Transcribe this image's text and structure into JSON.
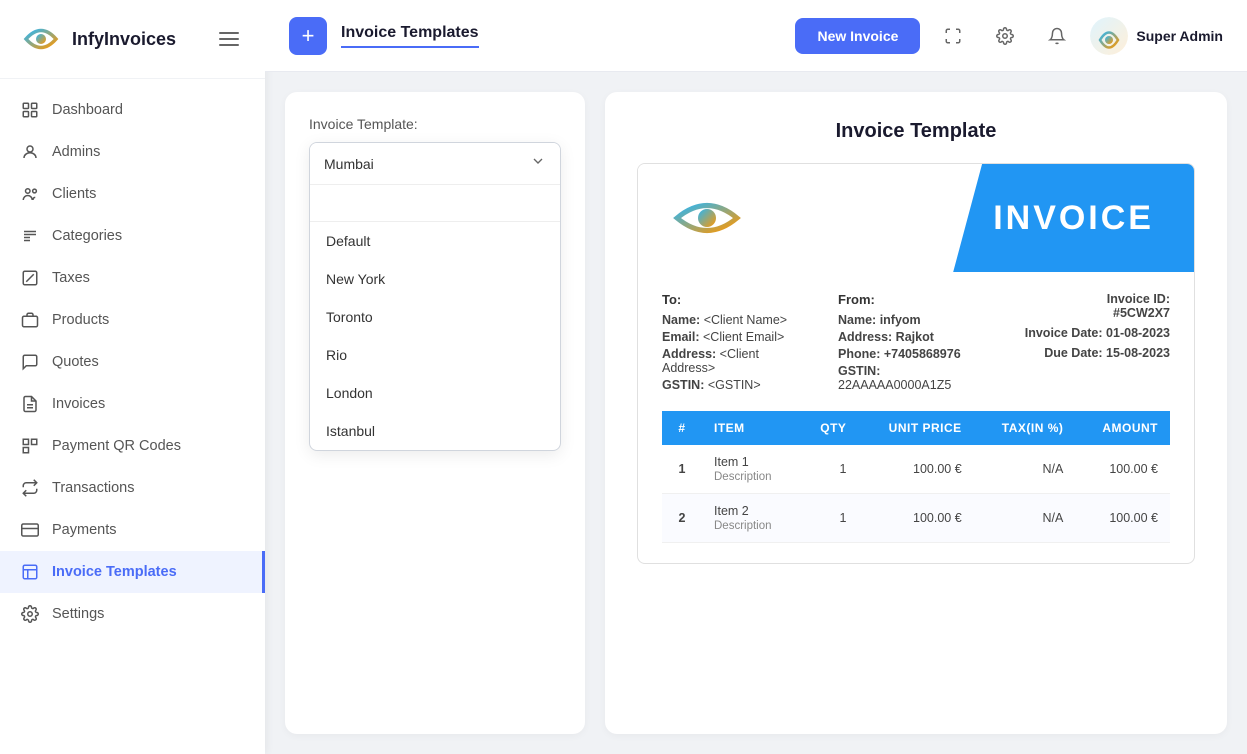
{
  "app": {
    "name": "InfyInvoices"
  },
  "sidebar": {
    "items": [
      {
        "id": "dashboard",
        "label": "Dashboard",
        "icon": "dashboard"
      },
      {
        "id": "admins",
        "label": "Admins",
        "icon": "admins"
      },
      {
        "id": "clients",
        "label": "Clients",
        "icon": "clients"
      },
      {
        "id": "categories",
        "label": "Categories",
        "icon": "categories"
      },
      {
        "id": "taxes",
        "label": "Taxes",
        "icon": "taxes"
      },
      {
        "id": "products",
        "label": "Products",
        "icon": "products"
      },
      {
        "id": "quotes",
        "label": "Quotes",
        "icon": "quotes"
      },
      {
        "id": "invoices",
        "label": "Invoices",
        "icon": "invoices"
      },
      {
        "id": "payment-qr-codes",
        "label": "Payment QR Codes",
        "icon": "qr"
      },
      {
        "id": "transactions",
        "label": "Transactions",
        "icon": "transactions"
      },
      {
        "id": "payments",
        "label": "Payments",
        "icon": "payments"
      },
      {
        "id": "invoice-templates",
        "label": "Invoice Templates",
        "icon": "templates"
      },
      {
        "id": "settings",
        "label": "Settings",
        "icon": "settings"
      }
    ]
  },
  "topbar": {
    "page_title": "Invoice Templates",
    "new_invoice_btn": "New Invoice",
    "user_name": "Super Admin"
  },
  "left_panel": {
    "label": "Invoice Template:",
    "selected": "Mumbai",
    "search_placeholder": "",
    "options": [
      {
        "value": "default",
        "label": "Default"
      },
      {
        "value": "new-york",
        "label": "New York"
      },
      {
        "value": "toronto",
        "label": "Toronto"
      },
      {
        "value": "rio",
        "label": "Rio"
      },
      {
        "value": "london",
        "label": "London"
      },
      {
        "value": "istanbul",
        "label": "Istanbul"
      }
    ]
  },
  "invoice_preview": {
    "panel_title": "Invoice Template",
    "header_text": "INVOICE",
    "to_section": {
      "label": "To:",
      "name_label": "Name:",
      "name_value": "<Client Name>",
      "email_label": "Email:",
      "email_value": "<Client Email>",
      "address_label": "Address:",
      "address_value": "<Client Address>",
      "gstin_label": "GSTIN:",
      "gstin_value": "<GSTIN>"
    },
    "from_section": {
      "label": "From:",
      "name_label": "Name:",
      "name_value": "infyom",
      "address_label": "Address:",
      "address_value": "Rajkot",
      "phone_label": "Phone:",
      "phone_value": "+7405868976",
      "gstin_label": "GSTIN:",
      "gstin_value": "22AAAAA0000A1Z5"
    },
    "meta": {
      "invoice_id_label": "Invoice ID:",
      "invoice_id_value": "#5CW2X7",
      "invoice_date_label": "Invoice Date:",
      "invoice_date_value": "01-08-2023",
      "due_date_label": "Due Date:",
      "due_date_value": "15-08-2023"
    },
    "table": {
      "headers": [
        "#",
        "ITEM",
        "QTY",
        "UNIT PRICE",
        "TAX(IN %)",
        "AMOUNT"
      ],
      "rows": [
        {
          "num": "1",
          "item": "Item 1",
          "desc": "Description",
          "qty": "1",
          "unit_price": "100.00 €",
          "tax": "N/A",
          "amount": "100.00 €"
        },
        {
          "num": "2",
          "item": "Item 2",
          "desc": "Description",
          "qty": "1",
          "unit_price": "100.00 €",
          "tax": "N/A",
          "amount": "100.00 €"
        }
      ]
    }
  },
  "colors": {
    "primary": "#4a6cf7",
    "invoice_blue": "#2196f3",
    "active_sidebar": "#eff3ff"
  }
}
